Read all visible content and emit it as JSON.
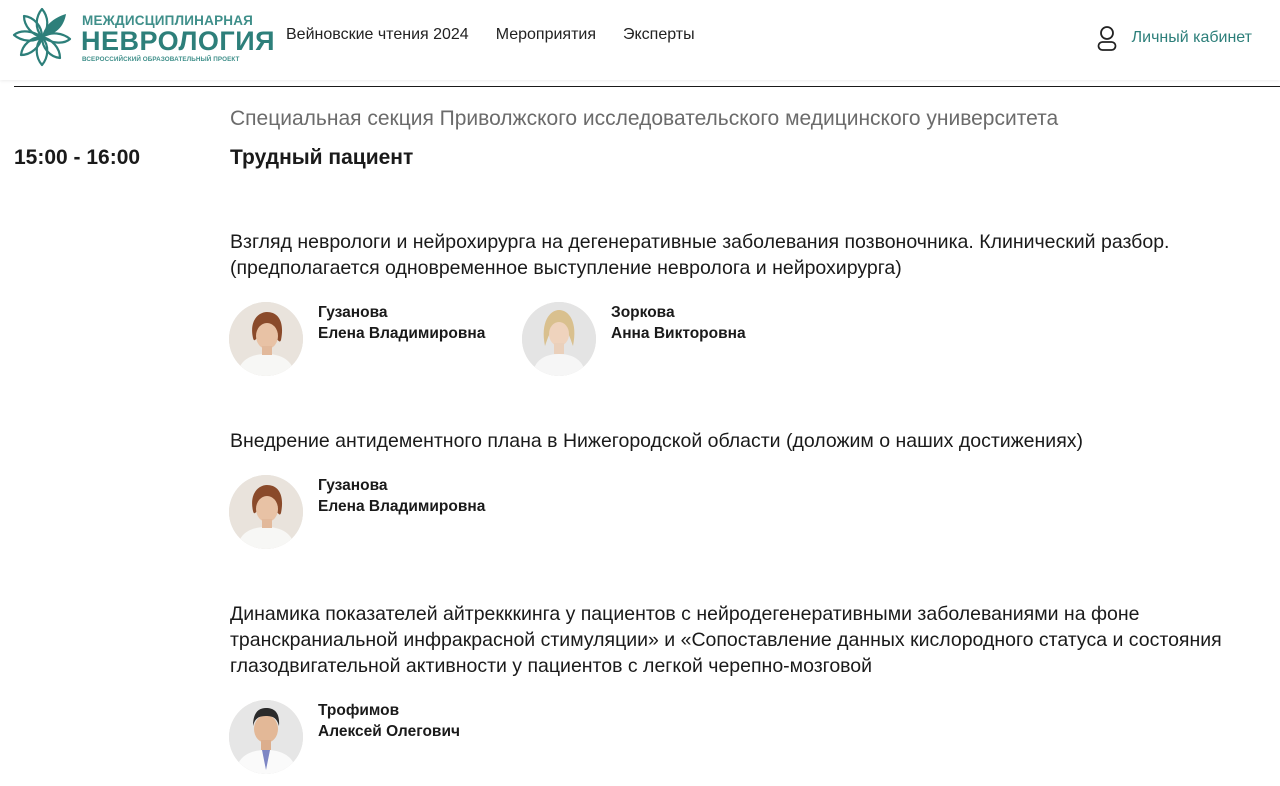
{
  "header": {
    "logo": {
      "top": "МЕЖДИСЦИПЛИНАРНАЯ",
      "main": "НЕВРОЛОГИЯ",
      "sub": "ВСЕРОССИЙСКИЙ ОБРАЗОВАТЕЛЬНЫЙ ПРОЕКТ"
    },
    "nav": [
      {
        "label": "Вейновские чтения 2024"
      },
      {
        "label": "Мероприятия"
      },
      {
        "label": "Эксперты"
      }
    ],
    "cabinet": {
      "label": "Личный кабинет",
      "icon": "user-icon"
    }
  },
  "colors": {
    "brand": "#2d7f7a",
    "text": "#1a1a1a",
    "muted": "#6b6b6b"
  },
  "session": {
    "section_title": "Специальная секция Приволжского исследовательского медицинского университета",
    "time": "15:00 - 16:00",
    "title": "Трудный пациент",
    "talks": [
      {
        "title": "Взгляд неврологи и нейрохирурга на дегенеративные заболевания позвоночника. Клинический разбор. (предполагается одновременное выступление невролога и нейрохирурга)",
        "speakers": [
          {
            "last": "Гузанова",
            "first": "Елена Владимировна"
          },
          {
            "last": "Зоркова",
            "first": "Анна Викторовна"
          }
        ]
      },
      {
        "title": "Внедрение антидементного плана в Нижегородской области (доложим о наших достижениях)",
        "speakers": [
          {
            "last": "Гузанова",
            "first": "Елена Владимировна"
          }
        ]
      },
      {
        "title": "Динамика показателей айтрекккинга у пациентов с нейродегенеративными заболеваниями на фоне транскраниальной инфракрасной стимуляции» и «Сопоставление данных кислородного статуса и состояния глазодвигательной активности у пациентов с легкой черепно-мозговой",
        "speakers": [
          {
            "last": "Трофимов",
            "first": "Алексей Олегович"
          }
        ]
      }
    ]
  }
}
